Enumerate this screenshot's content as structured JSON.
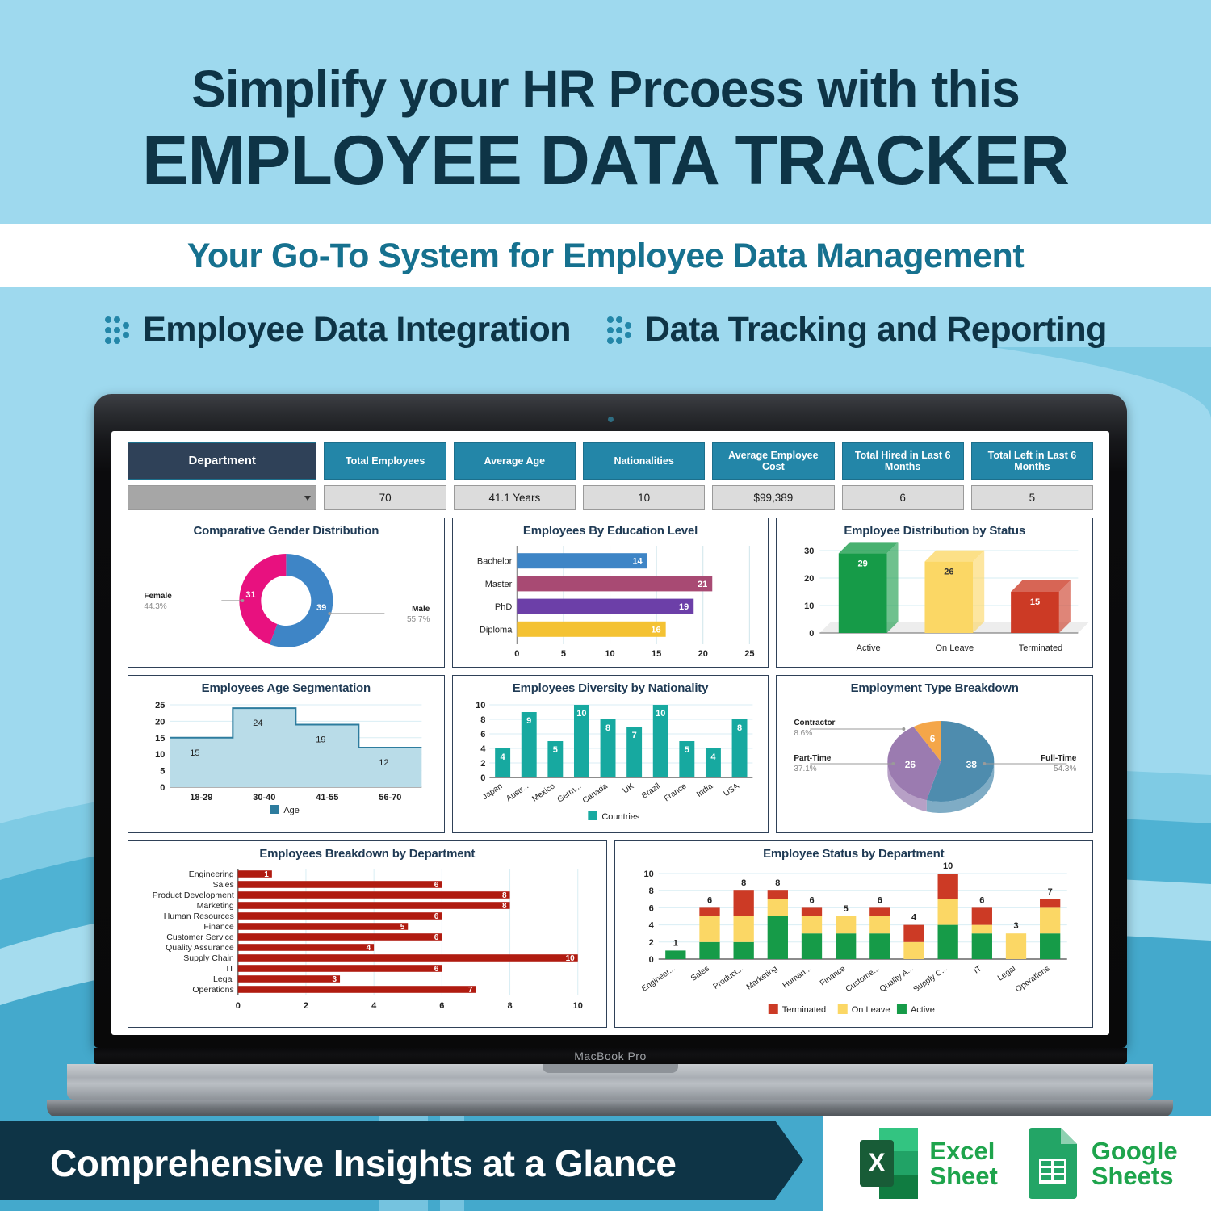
{
  "header": {
    "title_line1": "Simplify your HR Prcoess with this",
    "title_line2": "EMPLOYEE DATA TRACKER",
    "subtitle": "Your Go-To System for Employee Data Management",
    "features": [
      "Employee Data Integration",
      "Data Tracking and Reporting"
    ]
  },
  "laptop": {
    "model_label": "MacBook Pro"
  },
  "kpis": [
    {
      "label": "Department",
      "value": ""
    },
    {
      "label": "Total Employees",
      "value": "70"
    },
    {
      "label": "Average Age",
      "value": "41.1 Years"
    },
    {
      "label": "Nationalities",
      "value": "10"
    },
    {
      "label": "Average Employee Cost",
      "value": "$99,389"
    },
    {
      "label": "Total Hired in Last 6 Months",
      "value": "6"
    },
    {
      "label": "Total Left in Last 6 Months",
      "value": "5"
    }
  ],
  "footer": {
    "tagline": "Comprehensive Insights at a Glance",
    "logos": [
      {
        "name": "excel",
        "line1": "Excel",
        "line2": "Sheet"
      },
      {
        "name": "google-sheets",
        "line1": "Google",
        "line2": "Sheets"
      }
    ]
  },
  "colors": {
    "background": "#9ED9EE",
    "wave_mid": "#52B4D4",
    "wave_dark": "#3FA4C8",
    "dark_navy": "#0E3446",
    "teal": "#16718F",
    "kpi_header": "#2386A8",
    "kpi_dept_header": "#2F4158",
    "card_border": "#2F4158",
    "green": "#169B48",
    "yellow": "#FBD765",
    "red": "#CC3A25",
    "excel_green": "#1EA44C"
  },
  "chart_data": [
    {
      "type": "pie",
      "name": "comparative-gender-distribution",
      "title": "Comparative Gender Distribution",
      "donut": true,
      "labels": [
        "Female",
        "Male"
      ],
      "values": [
        31,
        39
      ],
      "percents": [
        "44.3%",
        "55.7%"
      ],
      "colors": [
        "#E8117F",
        "#3E85C6"
      ]
    },
    {
      "type": "bar",
      "name": "employees-by-education-level",
      "title": "Employees By Education Level",
      "orientation": "horizontal",
      "categories": [
        "Bachelor",
        "Master",
        "PhD",
        "Diploma"
      ],
      "values": [
        14,
        21,
        19,
        16
      ],
      "colors": [
        "#3E85C6",
        "#A84A73",
        "#6C3FA8",
        "#F4C233"
      ],
      "xlim": [
        0,
        25
      ],
      "xticks": [
        0,
        5,
        10,
        15,
        20,
        25
      ],
      "grid": true
    },
    {
      "type": "bar",
      "name": "employee-distribution-by-status",
      "title": "Employee Distribution by Status",
      "style": "3d",
      "categories": [
        "Active",
        "On Leave",
        "Terminated"
      ],
      "values": [
        29,
        26,
        15
      ],
      "colors": [
        "#169B48",
        "#FBD765",
        "#CC3A25"
      ],
      "ylim": [
        0,
        30
      ],
      "yticks": [
        0,
        10,
        20,
        30
      ],
      "grid": true
    },
    {
      "type": "area",
      "name": "employees-age-segmentation",
      "title": "Employees Age Segmentation",
      "step": true,
      "categories": [
        "18-29",
        "30-40",
        "41-55",
        "56-70"
      ],
      "values": [
        15,
        24,
        19,
        12
      ],
      "ylim": [
        0,
        25
      ],
      "yticks": [
        0,
        5,
        10,
        15,
        20,
        25
      ],
      "legend": [
        "Age"
      ],
      "legend_position": "bottom",
      "color": "#2D7C9E",
      "fill": "#B9DCE8",
      "grid": true
    },
    {
      "type": "bar",
      "name": "employees-diversity-by-nationality",
      "title": "Employees Diversity by Nationality",
      "categories": [
        "Japan",
        "Austr...",
        "Mexico",
        "Germ...",
        "Canada",
        "UK",
        "Brazil",
        "France",
        "India",
        "USA"
      ],
      "values": [
        4,
        9,
        5,
        10,
        8,
        7,
        10,
        5,
        4,
        8
      ],
      "ylim": [
        0,
        10
      ],
      "yticks": [
        0,
        2,
        4,
        6,
        8,
        10
      ],
      "legend": [
        "Countries"
      ],
      "legend_position": "bottom",
      "color": "#17A9A0",
      "grid": true
    },
    {
      "type": "pie",
      "name": "employment-type-breakdown",
      "title": "Employment Type Breakdown",
      "style": "3d",
      "labels": [
        "Full-Time",
        "Part-Time",
        "Contractor"
      ],
      "values": [
        38,
        26,
        6
      ],
      "percents": [
        "54.3%",
        "37.1%",
        "8.6%"
      ],
      "colors": [
        "#4E8CAE",
        "#9B7BB0",
        "#F4A649"
      ]
    },
    {
      "type": "bar",
      "name": "employees-breakdown-by-department",
      "title": "Employees Breakdown by Department",
      "orientation": "horizontal",
      "categories": [
        "Engineering",
        "Sales",
        "Product Development",
        "Marketing",
        "Human Resources",
        "Finance",
        "Customer Service",
        "Quality Assurance",
        "Supply Chain",
        "IT",
        "Legal",
        "Operations"
      ],
      "values": [
        1,
        6,
        8,
        8,
        6,
        5,
        6,
        4,
        10,
        6,
        3,
        7
      ],
      "color": "#B01B10",
      "xlim": [
        0,
        10
      ],
      "xticks": [
        0,
        2,
        4,
        6,
        8,
        10
      ],
      "grid": true
    },
    {
      "type": "bar",
      "name": "employee-status-by-department",
      "title": "Employee Status by Department",
      "stacked": true,
      "categories": [
        "Engineer...",
        "Sales",
        "Product...",
        "Marketing",
        "Human...",
        "Finance",
        "Custome...",
        "Quality A...",
        "Supply C...",
        "IT",
        "Legal",
        "Operations"
      ],
      "totals": [
        1,
        6,
        8,
        8,
        6,
        5,
        6,
        4,
        10,
        6,
        3,
        7
      ],
      "series": [
        {
          "name": "Active",
          "color": "#169B48",
          "values": [
            1,
            2,
            2,
            5,
            3,
            3,
            3,
            0,
            4,
            3,
            0,
            3
          ]
        },
        {
          "name": "On Leave",
          "color": "#FBD765",
          "values": [
            0,
            3,
            3,
            2,
            2,
            2,
            2,
            2,
            3,
            1,
            3,
            3
          ]
        },
        {
          "name": "Terminated",
          "color": "#CC3A25",
          "values": [
            0,
            1,
            3,
            1,
            1,
            0,
            1,
            2,
            3,
            2,
            0,
            1
          ]
        }
      ],
      "legend": [
        "Terminated",
        "On Leave",
        "Active"
      ],
      "legend_position": "bottom",
      "ylim": [
        0,
        10
      ],
      "yticks": [
        0,
        2,
        4,
        6,
        8,
        10
      ],
      "grid": true
    }
  ]
}
